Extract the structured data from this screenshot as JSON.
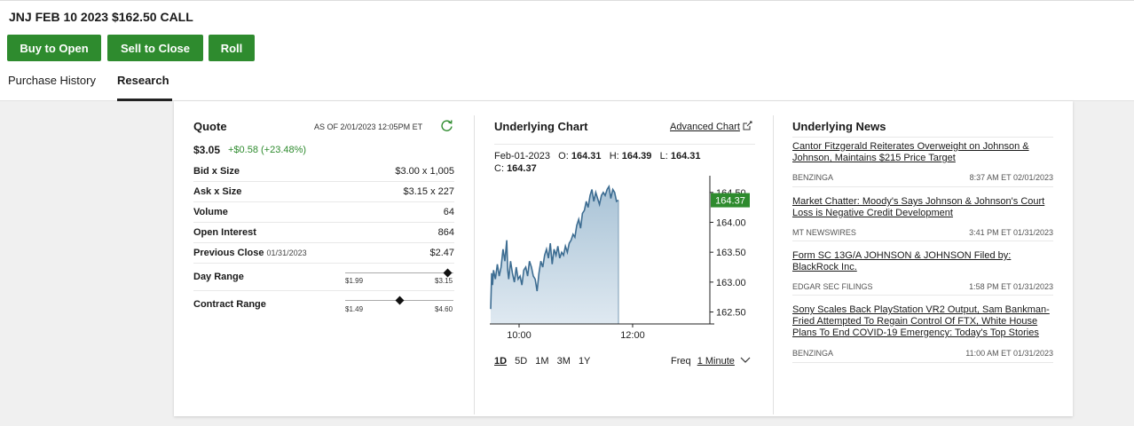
{
  "header": {
    "title": "JNJ FEB 10 2023 $162.50 CALL",
    "buttons": [
      "Buy to Open",
      "Sell to Close",
      "Roll"
    ],
    "tabs": [
      "Purchase History",
      "Research"
    ],
    "active_tab": "Research"
  },
  "quote": {
    "title": "Quote",
    "as_of": "AS OF 2/01/2023 12:05PM ET",
    "price": "$3.05",
    "change": "+$0.58 (+23.48%)",
    "rows": [
      {
        "label": "Bid x Size",
        "value": "$3.00 x 1,005"
      },
      {
        "label": "Ask x Size",
        "value": "$3.15 x 227"
      },
      {
        "label": "Volume",
        "value": "64"
      },
      {
        "label": "Open Interest",
        "value": "864"
      },
      {
        "label": "Previous Close",
        "sub": "01/31/2023",
        "value": "$2.47"
      }
    ],
    "day_range": {
      "label": "Day Range",
      "low": "$1.99",
      "high": "$3.15",
      "position": 0.95
    },
    "contract_range": {
      "label": "Contract Range",
      "low": "$1.49",
      "high": "$4.60",
      "position": 0.5
    }
  },
  "chart": {
    "title": "Underlying Chart",
    "advanced_link": "Advanced Chart",
    "date": "Feb-01-2023",
    "ohlc": {
      "o_label": "O:",
      "o": "164.31",
      "h_label": "H:",
      "h": "164.39",
      "l_label": "L:",
      "l": "164.31",
      "c_label": "C:",
      "c": "164.37"
    },
    "current_badge": "164.37",
    "ranges": [
      "1D",
      "5D",
      "1M",
      "3M",
      "1Y"
    ],
    "active_range": "1D",
    "freq_label": "Freq",
    "freq_value": "1 Minute",
    "accent": "#2e8b2e"
  },
  "chart_data": {
    "type": "area",
    "title": "",
    "xlabel": "",
    "ylabel": "",
    "x_ticks": [
      "10:00",
      "12:00"
    ],
    "y_ticks": [
      164.5,
      164.0,
      163.5,
      163.0,
      162.5
    ],
    "y_tick_labels": [
      "164.50",
      "164.00",
      "163.50",
      "163.00",
      "162.50"
    ],
    "ylim": [
      162.3,
      164.75
    ],
    "x_minutes_range": [
      570,
      720
    ],
    "series": [
      {
        "x": [
          570,
          571,
          572,
          573,
          575,
          577,
          579,
          581,
          583,
          585,
          587,
          588,
          589,
          591,
          593,
          595,
          597,
          599,
          601,
          603,
          605,
          607,
          609,
          611,
          613,
          615,
          617,
          619,
          621,
          623,
          625,
          627,
          629,
          631,
          633,
          635,
          637,
          639,
          641,
          643,
          645,
          647,
          649,
          651,
          653,
          655,
          657,
          659,
          661,
          663,
          665,
          667,
          669,
          671,
          673,
          675,
          677,
          679,
          681,
          683,
          685,
          687,
          689,
          691,
          693,
          695,
          697,
          699,
          701,
          703,
          705
        ],
        "values": [
          162.55,
          163.15,
          162.95,
          163.2,
          163.05,
          163.3,
          163.1,
          163.25,
          163.55,
          163.35,
          163.7,
          163.2,
          163.05,
          163.35,
          163.15,
          163.0,
          163.25,
          163.05,
          163.1,
          162.95,
          163.2,
          163.25,
          163.1,
          163.35,
          163.25,
          163.1,
          163.05,
          162.85,
          163.15,
          163.35,
          163.25,
          163.45,
          163.55,
          163.4,
          163.65,
          163.3,
          163.55,
          163.45,
          163.6,
          163.4,
          163.5,
          163.45,
          163.6,
          163.5,
          163.65,
          163.7,
          163.8,
          163.75,
          163.95,
          164.05,
          163.9,
          164.15,
          164.2,
          164.35,
          164.25,
          164.45,
          164.55,
          164.35,
          164.5,
          164.4,
          164.3,
          164.45,
          164.5,
          164.45,
          164.55,
          164.6,
          164.4,
          164.55,
          164.5,
          164.35,
          164.37
        ]
      }
    ],
    "grid": false
  },
  "news": {
    "title": "Underlying News",
    "items": [
      {
        "headline": "Cantor Fitzgerald Reiterates Overweight on Johnson & Johnson, Maintains $215 Price Target",
        "source": "BENZINGA",
        "time": "8:37 AM ET 02/01/2023"
      },
      {
        "headline": "Market Chatter: Moody's Says Johnson & Johnson's Court Loss is Negative Credit Development",
        "source": "MT NEWSWIRES",
        "time": "3:41 PM ET 01/31/2023"
      },
      {
        "headline": "Form SC 13G/A JOHNSON & JOHNSON Filed by: BlackRock Inc.",
        "source": "EDGAR SEC FILINGS",
        "time": "1:58 PM ET 01/31/2023"
      },
      {
        "headline": "Sony Scales Back PlayStation VR2 Output, Sam Bankman-Fried Attempted To Regain Control Of FTX, White House Plans To End COVID-19 Emergency: Today's Top Stories",
        "source": "BENZINGA",
        "time": "11:00 AM ET 01/31/2023"
      }
    ]
  }
}
